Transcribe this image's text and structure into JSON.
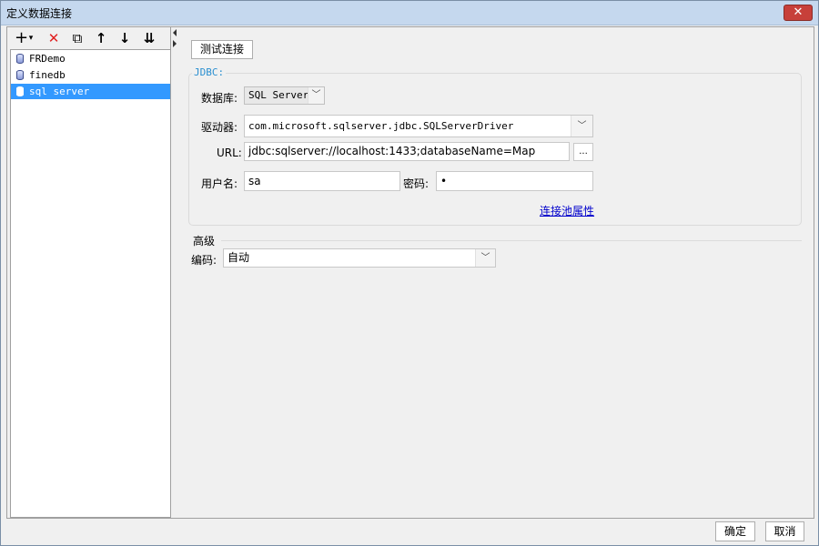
{
  "window": {
    "title": "定义数据连接",
    "close_label": "✕"
  },
  "toolbar": {
    "add": "+",
    "add_dropdown": "▾",
    "delete": "✕",
    "copy": "⧉",
    "move_up": "↑",
    "move_down": "↓",
    "sort": "⇊"
  },
  "connections": [
    {
      "name": "FRDemo"
    },
    {
      "name": "finedb"
    },
    {
      "name": "sql server"
    }
  ],
  "test_button": "测试连接",
  "jdbc": {
    "legend": "JDBC:",
    "database_label": "数据库:",
    "database_value": "SQL Server",
    "driver_label": "驱动器:",
    "driver_value": "com.microsoft.sqlserver.jdbc.SQLServerDriver",
    "url_label": "URL:",
    "url_value": "jdbc:sqlserver://localhost:1433;databaseName=Map",
    "browse_label": "...",
    "username_label": "用户名:",
    "username_value": "sa",
    "password_label": "密码:",
    "password_value": "•",
    "pool_link": "连接池属性"
  },
  "advanced": {
    "title": "高级",
    "encoding_label": "编码:",
    "encoding_value": "自动"
  },
  "footer": {
    "ok": "确定",
    "cancel": "取消"
  },
  "icons": {
    "dropdown": "chevron-down-icon",
    "connection": "database-icon"
  }
}
